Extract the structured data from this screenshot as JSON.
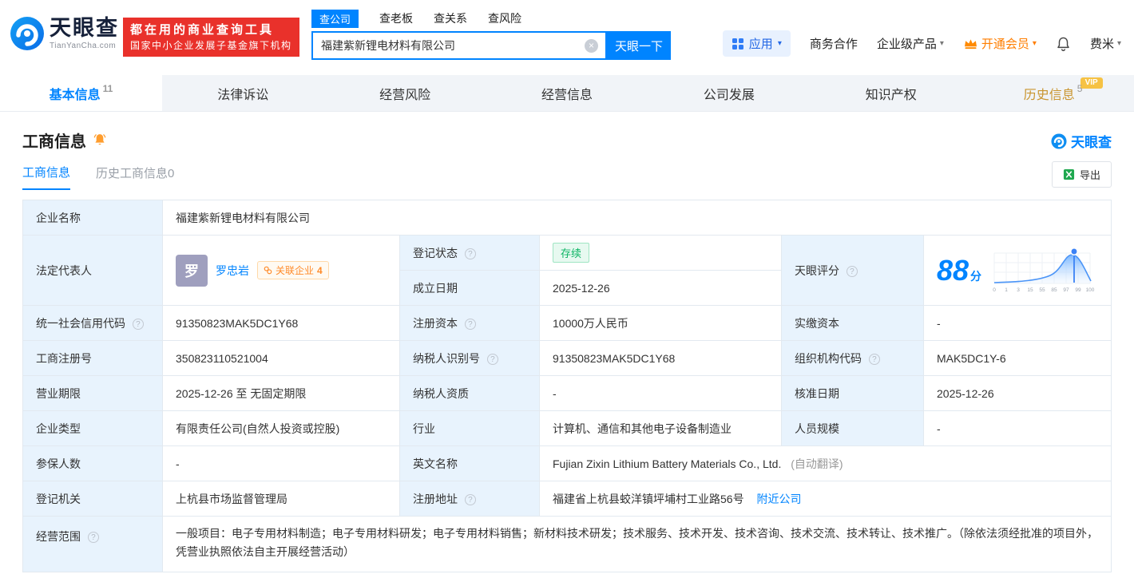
{
  "brand": {
    "name": "天眼查",
    "domain": "TianYanCha.com",
    "accent": "#0084ff"
  },
  "icons": {
    "help": "?",
    "clear": "×",
    "caret": "▾",
    "excel": "X"
  },
  "promo": {
    "line1": "都在用的商业查询工具",
    "line2": "国家中小企业发展子基金旗下机构"
  },
  "search": {
    "tabs": [
      {
        "label": "查公司"
      },
      {
        "label": "查老板"
      },
      {
        "label": "查关系"
      },
      {
        "label": "查风险"
      }
    ],
    "value": "福建紫新锂电材料有限公司",
    "button": "天眼一下"
  },
  "topnav": {
    "apps": "应用",
    "cooperation": "商务合作",
    "enterprise": "企业级产品",
    "membership": "开通会员",
    "user": "费米"
  },
  "tabs": [
    {
      "label": "基本信息",
      "count": "11"
    },
    {
      "label": "法律诉讼",
      "count": ""
    },
    {
      "label": "经营风险",
      "count": ""
    },
    {
      "label": "经营信息",
      "count": ""
    },
    {
      "label": "公司发展",
      "count": ""
    },
    {
      "label": "知识产权",
      "count": ""
    },
    {
      "label": "历史信息",
      "count": "5",
      "badge": "VIP"
    }
  ],
  "section": {
    "title": "工商信息",
    "watermark": "天眼查",
    "subtab_active": "工商信息",
    "subtab_history": "历史工商信息0",
    "export": "导出"
  },
  "info": {
    "company_name": {
      "label": "企业名称",
      "value": "福建紫新锂电材料有限公司"
    },
    "legal_rep": {
      "label": "法定代表人",
      "avatar": "罗",
      "name": "罗忠岩",
      "related_label": "关联企业",
      "related_count": "4"
    },
    "reg_status": {
      "label": "登记状态",
      "value": "存续"
    },
    "establish_date": {
      "label": "成立日期",
      "value": "2025-12-26"
    },
    "score": {
      "label": "天眼评分",
      "value": "88",
      "unit": "分"
    },
    "credit_code": {
      "label": "统一社会信用代码",
      "value": "91350823MAK5DC1Y68"
    },
    "reg_capital": {
      "label": "注册资本",
      "value": "10000万人民币"
    },
    "paid_capital": {
      "label": "实缴资本",
      "value": "-"
    },
    "reg_no": {
      "label": "工商注册号",
      "value": "350823110521004"
    },
    "taxpayer_no": {
      "label": "纳税人识别号",
      "value": "91350823MAK5DC1Y68"
    },
    "org_code": {
      "label": "组织机构代码",
      "value": "MAK5DC1Y-6"
    },
    "term": {
      "label": "营业期限",
      "value": "2025-12-26 至 无固定期限"
    },
    "taxpayer_quality": {
      "label": "纳税人资质",
      "value": "-"
    },
    "approve_date": {
      "label": "核准日期",
      "value": "2025-12-26"
    },
    "company_type": {
      "label": "企业类型",
      "value": "有限责任公司(自然人投资或控股)"
    },
    "industry": {
      "label": "行业",
      "value": "计算机、通信和其他电子设备制造业"
    },
    "staff_size": {
      "label": "人员规模",
      "value": "-"
    },
    "insured_num": {
      "label": "参保人数",
      "value": "-"
    },
    "english_name": {
      "label": "英文名称",
      "value": "Fujian Zixin Lithium Battery Materials Co., Ltd.",
      "note": "(自动翻译)"
    },
    "reg_org": {
      "label": "登记机关",
      "value": "上杭县市场监督管理局"
    },
    "address": {
      "label": "注册地址",
      "value": "福建省上杭县蛟洋镇坪埔村工业路56号",
      "link": "附近公司"
    },
    "scope": {
      "label": "经营范围",
      "value": "一般项目：电子专用材料制造；电子专用材料研发；电子专用材料销售；新材料技术研发；技术服务、技术开发、技术咨询、技术交流、技术转让、技术推广。（除依法须经批准的项目外，凭营业执照依法自主开展经营活动）"
    }
  },
  "score_chart": {
    "type": "area",
    "ticks": [
      "0",
      "1",
      "3",
      "15",
      "55",
      "85",
      "97",
      "99",
      "100"
    ]
  }
}
